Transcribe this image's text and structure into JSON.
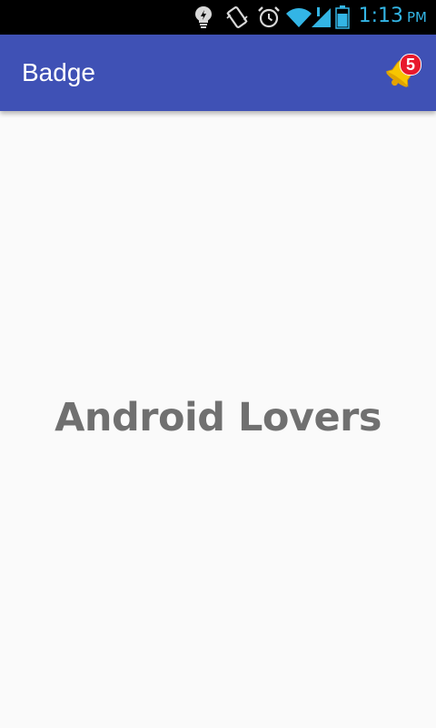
{
  "status_bar": {
    "time": "1:13",
    "ampm": "PM",
    "icons": [
      "lightbulb-icon",
      "vibrate-icon",
      "alarm-icon",
      "wifi-icon",
      "signal-icon",
      "battery-icon"
    ],
    "icon_color": "#33b5e5"
  },
  "app_bar": {
    "title": "Badge",
    "background_color": "#3f51b5",
    "notification_icon": "bell-icon",
    "badge_count": "5",
    "badge_color": "#e8192c"
  },
  "main": {
    "text": "Android Lovers",
    "text_color": "#707070"
  }
}
